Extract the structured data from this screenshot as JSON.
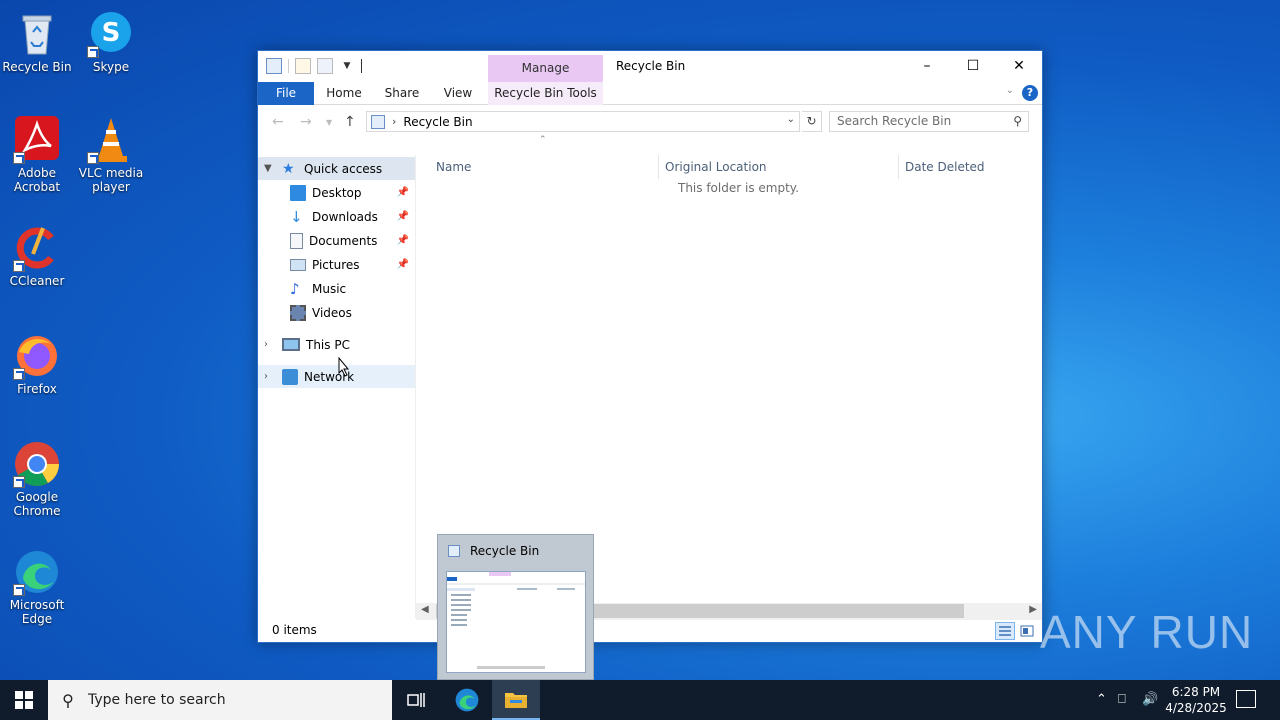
{
  "desktop": {
    "icons": [
      {
        "name": "Recycle Bin"
      },
      {
        "name": "Skype"
      },
      {
        "name": "Adobe Acrobat"
      },
      {
        "name": "VLC media player"
      },
      {
        "name": "CCleaner"
      },
      {
        "name": "Firefox"
      },
      {
        "name": "Google Chrome"
      },
      {
        "name": "Microsoft Edge"
      }
    ]
  },
  "window": {
    "title": "Recycle Bin",
    "contextual_group": "Manage",
    "ribbon_tabs": [
      "File",
      "Home",
      "Share",
      "View",
      "Recycle Bin Tools"
    ],
    "address": {
      "path": "Recycle Bin"
    },
    "search_placeholder": "Search Recycle Bin",
    "nav": {
      "quick_access": "Quick access",
      "items": [
        "Desktop",
        "Downloads",
        "Documents",
        "Pictures",
        "Music",
        "Videos"
      ],
      "this_pc": "This PC",
      "network": "Network"
    },
    "columns": [
      "Name",
      "Original Location",
      "Date Deleted"
    ],
    "empty_message": "This folder is empty.",
    "status": "0 items"
  },
  "thumbnail_preview": {
    "title": "Recycle Bin"
  },
  "watermark": "ANY RUN",
  "taskbar": {
    "search_placeholder": "Type here to search",
    "time": "6:28 PM",
    "date": "4/28/2025"
  }
}
